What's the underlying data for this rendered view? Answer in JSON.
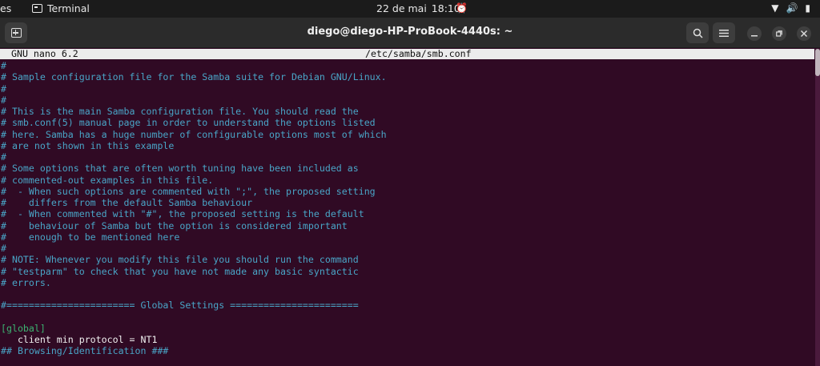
{
  "topbar": {
    "activities": "es",
    "app_name": "Terminal",
    "date": "22 de mai",
    "time": "18:10"
  },
  "window": {
    "title": "diego@diego-HP-ProBook-4440s: ~"
  },
  "nano": {
    "version": "GNU nano 6.2",
    "filename": "/etc/samba/smb.conf"
  },
  "lines": [
    {
      "text": "#",
      "kind": "comment"
    },
    {
      "text": "# Sample configuration file for the Samba suite for Debian GNU/Linux.",
      "kind": "comment"
    },
    {
      "text": "#",
      "kind": "comment"
    },
    {
      "text": "#",
      "kind": "comment"
    },
    {
      "text": "# This is the main Samba configuration file. You should read the",
      "kind": "comment"
    },
    {
      "text": "# smb.conf(5) manual page in order to understand the options listed",
      "kind": "comment"
    },
    {
      "text": "# here. Samba has a huge number of configurable options most of which",
      "kind": "comment"
    },
    {
      "text": "# are not shown in this example",
      "kind": "comment"
    },
    {
      "text": "#",
      "kind": "comment"
    },
    {
      "text": "# Some options that are often worth tuning have been included as",
      "kind": "comment"
    },
    {
      "text": "# commented-out examples in this file.",
      "kind": "comment"
    },
    {
      "text": "#  - When such options are commented with \";\", the proposed setting",
      "kind": "comment"
    },
    {
      "text": "#    differs from the default Samba behaviour",
      "kind": "comment"
    },
    {
      "text": "#  - When commented with \"#\", the proposed setting is the default",
      "kind": "comment"
    },
    {
      "text": "#    behaviour of Samba but the option is considered important",
      "kind": "comment"
    },
    {
      "text": "#    enough to be mentioned here",
      "kind": "comment"
    },
    {
      "text": "#",
      "kind": "comment"
    },
    {
      "text": "# NOTE: Whenever you modify this file you should run the command",
      "kind": "comment"
    },
    {
      "text": "# \"testparm\" to check that you have not made any basic syntactic",
      "kind": "comment"
    },
    {
      "text": "# errors.",
      "kind": "comment"
    },
    {
      "text": "",
      "kind": "plain"
    },
    {
      "text": "#======================= Global Settings =======================",
      "kind": "comment"
    },
    {
      "text": "",
      "kind": "plain"
    },
    {
      "text": "[global]",
      "kind": "section"
    },
    {
      "text": "   client min protocol = NT1",
      "kind": "plain"
    },
    {
      "text": "## Browsing/Identification ###",
      "kind": "comment"
    }
  ]
}
